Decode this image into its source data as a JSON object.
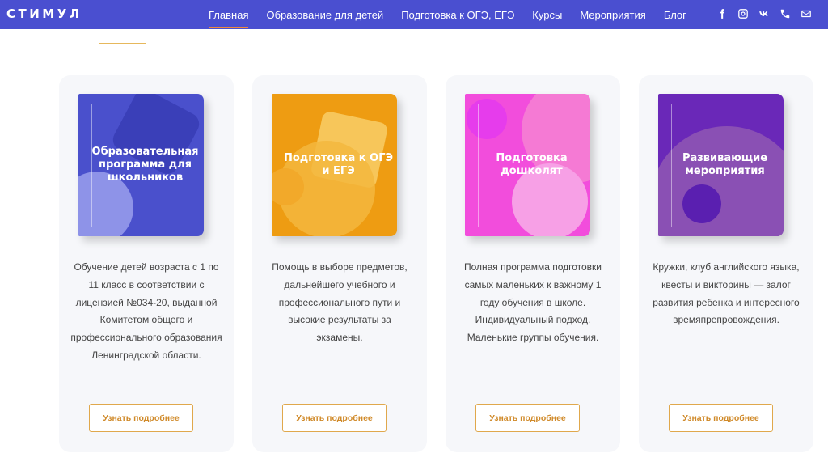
{
  "brand": {
    "logo": "СТИМУЛ",
    "color": "#4a4fd0",
    "accent": "#f08a3c"
  },
  "nav": {
    "items": [
      {
        "label": "Главная",
        "active": true
      },
      {
        "label": "Образование для детей",
        "active": false
      },
      {
        "label": "Подготовка к ОГЭ, ЕГЭ",
        "active": false
      },
      {
        "label": "Курсы",
        "active": false
      },
      {
        "label": "Мероприятия",
        "active": false
      },
      {
        "label": "Блог",
        "active": false
      }
    ]
  },
  "socials": [
    "facebook-icon",
    "instagram-icon",
    "vk-icon",
    "phone-icon",
    "mail-icon"
  ],
  "cards": [
    {
      "book_title": "Образовательная программа для школьников",
      "book_color": "#4a50cc",
      "description": "Обучение детей возраста с 1 по 11 класс в соответствии с лицензией №034-20, выданной Комитетом общего и профессионального образования Ленинградской области.",
      "button": "Узнать подробнее"
    },
    {
      "book_title": "Подготовка к ОГЭ и ЕГЭ",
      "book_color": "#ee9c12",
      "description": "Помощь в выборе предметов, дальнейшего учебного и профессионального пути и высокие результаты за экзамены.",
      "button": "Узнать подробнее"
    },
    {
      "book_title": "Подготовка дошколят",
      "book_color": "#f24ddc",
      "description": "Полная программа подготовки самых маленьких к важному 1 году обучения в школе. Индивидуальный подход. Маленькие группы обучения.",
      "button": "Узнать подробнее"
    },
    {
      "book_title": "Развивающие мероприятия",
      "book_color": "#6a28b8",
      "description": "Кружки, клуб английского языка, квесты и викторины — залог развития ребенка и интересного времяпрепровождения.",
      "button": "Узнать подробнее"
    }
  ]
}
